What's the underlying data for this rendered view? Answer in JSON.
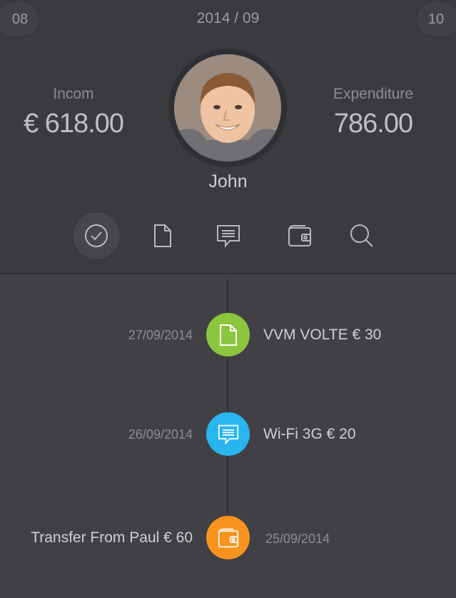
{
  "header": {
    "prev_month": "08",
    "current_month": "2014 / 09",
    "next_month": "10"
  },
  "income": {
    "label": "Incom",
    "value": "€ 618.00"
  },
  "expenditure": {
    "label": "Expenditure",
    "value": "786.00"
  },
  "user": {
    "name": "John"
  },
  "toolbar": {
    "items": [
      {
        "icon": "check-circle-icon",
        "active": true
      },
      {
        "icon": "document-icon",
        "active": false
      },
      {
        "icon": "chat-icon",
        "active": false
      },
      {
        "icon": "wallet-icon",
        "active": false
      },
      {
        "icon": "search-icon",
        "active": false
      }
    ]
  },
  "timeline": {
    "entries": [
      {
        "date": "27/09/2014",
        "title": "VVM VOLTE € 30",
        "icon": "document-icon",
        "color": "#8cc63f",
        "side": "right"
      },
      {
        "date": "26/09/2014",
        "title": "Wi-Fi 3G € 20",
        "icon": "chat-icon",
        "color": "#29b6f0",
        "side": "right"
      },
      {
        "date": "25/09/2014",
        "title": "Transfer From Paul € 60",
        "icon": "wallet-icon",
        "color": "#f7931e",
        "side": "left"
      }
    ]
  },
  "colors": {
    "header_bg": "#3a3b3f",
    "body_bg": "#414145",
    "green": "#8cc63f",
    "blue": "#29b6f0",
    "orange": "#f7931e"
  }
}
